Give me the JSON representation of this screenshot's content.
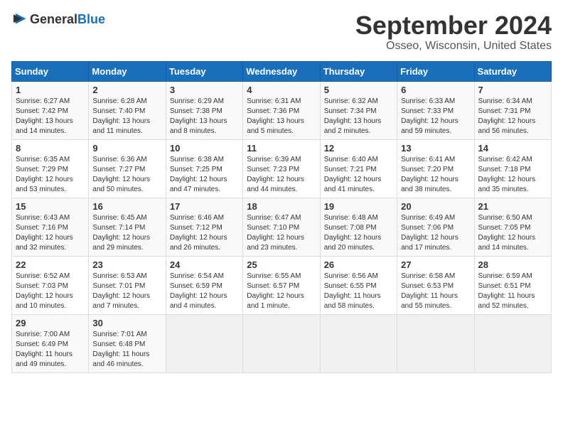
{
  "header": {
    "logo_general": "General",
    "logo_blue": "Blue",
    "month": "September 2024",
    "location": "Osseo, Wisconsin, United States"
  },
  "weekdays": [
    "Sunday",
    "Monday",
    "Tuesday",
    "Wednesday",
    "Thursday",
    "Friday",
    "Saturday"
  ],
  "weeks": [
    [
      {
        "day": "1",
        "lines": [
          "Sunrise: 6:27 AM",
          "Sunset: 7:42 PM",
          "Daylight: 13 hours",
          "and 14 minutes."
        ]
      },
      {
        "day": "2",
        "lines": [
          "Sunrise: 6:28 AM",
          "Sunset: 7:40 PM",
          "Daylight: 13 hours",
          "and 11 minutes."
        ]
      },
      {
        "day": "3",
        "lines": [
          "Sunrise: 6:29 AM",
          "Sunset: 7:38 PM",
          "Daylight: 13 hours",
          "and 8 minutes."
        ]
      },
      {
        "day": "4",
        "lines": [
          "Sunrise: 6:31 AM",
          "Sunset: 7:36 PM",
          "Daylight: 13 hours",
          "and 5 minutes."
        ]
      },
      {
        "day": "5",
        "lines": [
          "Sunrise: 6:32 AM",
          "Sunset: 7:34 PM",
          "Daylight: 13 hours",
          "and 2 minutes."
        ]
      },
      {
        "day": "6",
        "lines": [
          "Sunrise: 6:33 AM",
          "Sunset: 7:33 PM",
          "Daylight: 12 hours",
          "and 59 minutes."
        ]
      },
      {
        "day": "7",
        "lines": [
          "Sunrise: 6:34 AM",
          "Sunset: 7:31 PM",
          "Daylight: 12 hours",
          "and 56 minutes."
        ]
      }
    ],
    [
      {
        "day": "8",
        "lines": [
          "Sunrise: 6:35 AM",
          "Sunset: 7:29 PM",
          "Daylight: 12 hours",
          "and 53 minutes."
        ]
      },
      {
        "day": "9",
        "lines": [
          "Sunrise: 6:36 AM",
          "Sunset: 7:27 PM",
          "Daylight: 12 hours",
          "and 50 minutes."
        ]
      },
      {
        "day": "10",
        "lines": [
          "Sunrise: 6:38 AM",
          "Sunset: 7:25 PM",
          "Daylight: 12 hours",
          "and 47 minutes."
        ]
      },
      {
        "day": "11",
        "lines": [
          "Sunrise: 6:39 AM",
          "Sunset: 7:23 PM",
          "Daylight: 12 hours",
          "and 44 minutes."
        ]
      },
      {
        "day": "12",
        "lines": [
          "Sunrise: 6:40 AM",
          "Sunset: 7:21 PM",
          "Daylight: 12 hours",
          "and 41 minutes."
        ]
      },
      {
        "day": "13",
        "lines": [
          "Sunrise: 6:41 AM",
          "Sunset: 7:20 PM",
          "Daylight: 12 hours",
          "and 38 minutes."
        ]
      },
      {
        "day": "14",
        "lines": [
          "Sunrise: 6:42 AM",
          "Sunset: 7:18 PM",
          "Daylight: 12 hours",
          "and 35 minutes."
        ]
      }
    ],
    [
      {
        "day": "15",
        "lines": [
          "Sunrise: 6:43 AM",
          "Sunset: 7:16 PM",
          "Daylight: 12 hours",
          "and 32 minutes."
        ]
      },
      {
        "day": "16",
        "lines": [
          "Sunrise: 6:45 AM",
          "Sunset: 7:14 PM",
          "Daylight: 12 hours",
          "and 29 minutes."
        ]
      },
      {
        "day": "17",
        "lines": [
          "Sunrise: 6:46 AM",
          "Sunset: 7:12 PM",
          "Daylight: 12 hours",
          "and 26 minutes."
        ]
      },
      {
        "day": "18",
        "lines": [
          "Sunrise: 6:47 AM",
          "Sunset: 7:10 PM",
          "Daylight: 12 hours",
          "and 23 minutes."
        ]
      },
      {
        "day": "19",
        "lines": [
          "Sunrise: 6:48 AM",
          "Sunset: 7:08 PM",
          "Daylight: 12 hours",
          "and 20 minutes."
        ]
      },
      {
        "day": "20",
        "lines": [
          "Sunrise: 6:49 AM",
          "Sunset: 7:06 PM",
          "Daylight: 12 hours",
          "and 17 minutes."
        ]
      },
      {
        "day": "21",
        "lines": [
          "Sunrise: 6:50 AM",
          "Sunset: 7:05 PM",
          "Daylight: 12 hours",
          "and 14 minutes."
        ]
      }
    ],
    [
      {
        "day": "22",
        "lines": [
          "Sunrise: 6:52 AM",
          "Sunset: 7:03 PM",
          "Daylight: 12 hours",
          "and 10 minutes."
        ]
      },
      {
        "day": "23",
        "lines": [
          "Sunrise: 6:53 AM",
          "Sunset: 7:01 PM",
          "Daylight: 12 hours",
          "and 7 minutes."
        ]
      },
      {
        "day": "24",
        "lines": [
          "Sunrise: 6:54 AM",
          "Sunset: 6:59 PM",
          "Daylight: 12 hours",
          "and 4 minutes."
        ]
      },
      {
        "day": "25",
        "lines": [
          "Sunrise: 6:55 AM",
          "Sunset: 6:57 PM",
          "Daylight: 12 hours",
          "and 1 minute."
        ]
      },
      {
        "day": "26",
        "lines": [
          "Sunrise: 6:56 AM",
          "Sunset: 6:55 PM",
          "Daylight: 11 hours",
          "and 58 minutes."
        ]
      },
      {
        "day": "27",
        "lines": [
          "Sunrise: 6:58 AM",
          "Sunset: 6:53 PM",
          "Daylight: 11 hours",
          "and 55 minutes."
        ]
      },
      {
        "day": "28",
        "lines": [
          "Sunrise: 6:59 AM",
          "Sunset: 6:51 PM",
          "Daylight: 11 hours",
          "and 52 minutes."
        ]
      }
    ],
    [
      {
        "day": "29",
        "lines": [
          "Sunrise: 7:00 AM",
          "Sunset: 6:49 PM",
          "Daylight: 11 hours",
          "and 49 minutes."
        ]
      },
      {
        "day": "30",
        "lines": [
          "Sunrise: 7:01 AM",
          "Sunset: 6:48 PM",
          "Daylight: 11 hours",
          "and 46 minutes."
        ]
      },
      {
        "day": "",
        "lines": []
      },
      {
        "day": "",
        "lines": []
      },
      {
        "day": "",
        "lines": []
      },
      {
        "day": "",
        "lines": []
      },
      {
        "day": "",
        "lines": []
      }
    ]
  ]
}
